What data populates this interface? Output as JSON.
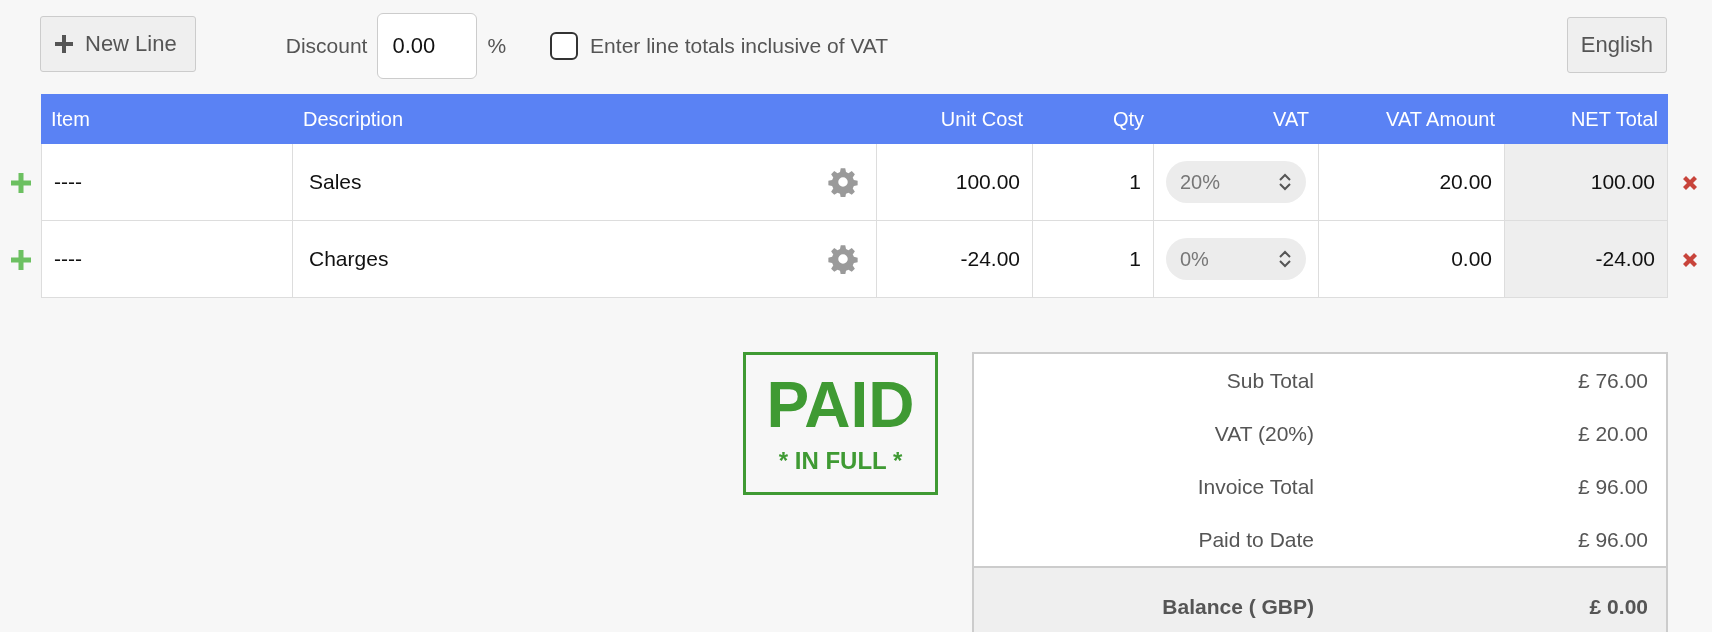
{
  "toolbar": {
    "new_line": "New Line",
    "discount_label": "Discount",
    "discount_value": "0.00",
    "percent": "%",
    "inclusive_vat": {
      "label": "Enter line totals inclusive of VAT",
      "checked": false
    },
    "language": "English"
  },
  "table": {
    "columns": [
      "Item",
      "Description",
      "Unit Cost",
      "Qty",
      "VAT",
      "VAT Amount",
      "NET Total"
    ],
    "rows": [
      {
        "item": "----",
        "description": "Sales",
        "unit_cost": "100.00",
        "qty": "1",
        "vat": "20%",
        "vat_amount": "20.00",
        "net_total": "100.00"
      },
      {
        "item": "----",
        "description": "Charges",
        "unit_cost": "-24.00",
        "qty": "1",
        "vat": "0%",
        "vat_amount": "0.00",
        "net_total": "-24.00"
      }
    ]
  },
  "stamp": {
    "title": "PAID",
    "subtitle": "* IN FULL *"
  },
  "totals": [
    {
      "kind": "line",
      "label": "Sub Total",
      "value": "£ 76.00"
    },
    {
      "kind": "line",
      "label": "VAT (20%)",
      "value": "£ 20.00"
    },
    {
      "kind": "line",
      "label": "Invoice Total",
      "value": "£ 96.00"
    },
    {
      "kind": "line",
      "label": "Paid to Date",
      "value": "£ 96.00"
    },
    {
      "kind": "balance",
      "label": "Balance ( GBP)",
      "value": "£ 0.00"
    }
  ]
}
